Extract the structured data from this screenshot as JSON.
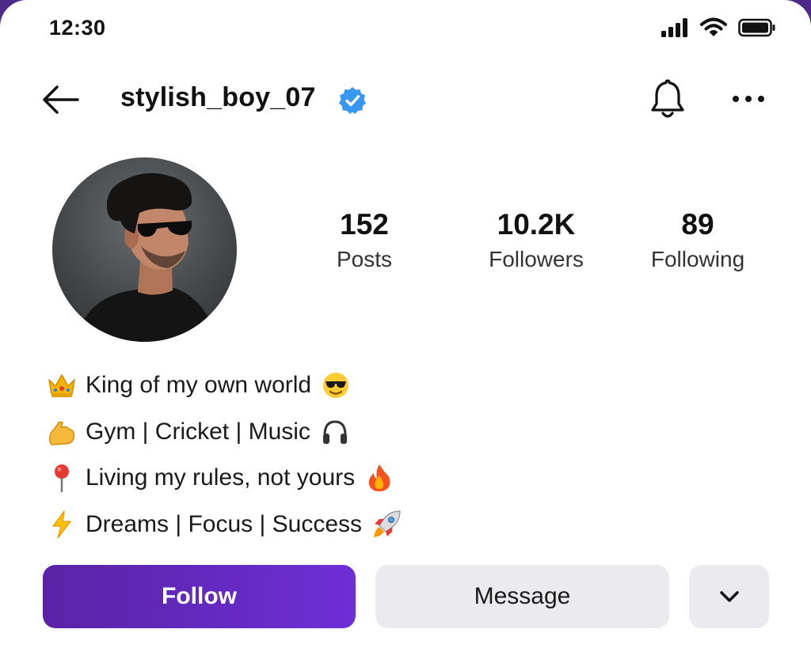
{
  "status_bar": {
    "time": "12:30",
    "icons": [
      "cellular-signal-icon",
      "wifi-icon",
      "battery-icon"
    ]
  },
  "header": {
    "username": "stylish_boy_07",
    "verified": true,
    "icons": [
      "back-arrow-icon",
      "verified-badge-icon",
      "bell-icon",
      "more-horizontal-icon"
    ]
  },
  "profile": {
    "avatar": "profile-photo",
    "stats": [
      {
        "value": "152",
        "label": "Posts"
      },
      {
        "value": "10.2K",
        "label": "Followers"
      },
      {
        "value": "89",
        "label": "Following"
      }
    ]
  },
  "bio": {
    "lines": [
      {
        "lead_icon": "crown-icon",
        "text": "King of my own world",
        "trail_icon": "sunglasses-face-icon"
      },
      {
        "lead_icon": "flexed-biceps-icon",
        "text": "Gym | Cricket | Music",
        "trail_icon": "headphones-icon"
      },
      {
        "lead_icon": "round-pushpin-icon",
        "text": "Living my rules, not yours",
        "trail_icon": "fire-icon"
      },
      {
        "lead_icon": "high-voltage-icon",
        "text": "Dreams | Focus | Success",
        "trail_icon": "rocket-icon"
      }
    ]
  },
  "actions": {
    "follow_label": "Follow",
    "message_label": "Message",
    "more_icon": "chevron-down-icon"
  },
  "colors": {
    "accent": "#6a2cc9",
    "verified": "#3897f0",
    "secondary_button": "#ebebef"
  }
}
